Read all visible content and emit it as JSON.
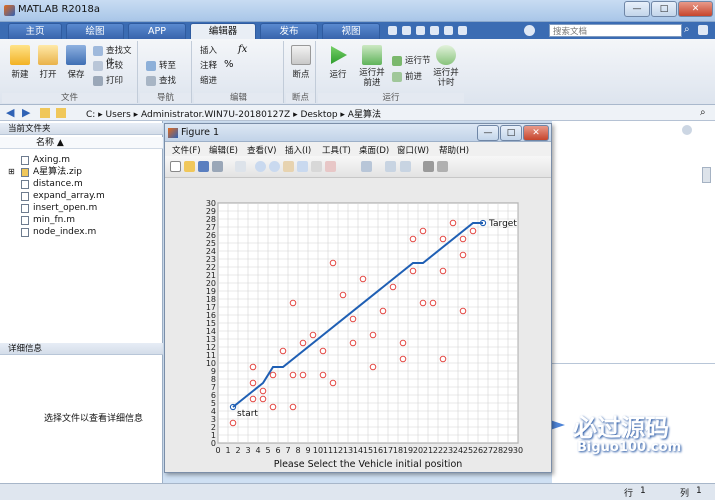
{
  "window": {
    "title": "MATLAB R2018a",
    "min": "—",
    "max": "□",
    "close": "✕"
  },
  "tabs": [
    {
      "label": "主页",
      "active": false
    },
    {
      "label": "绘图",
      "active": false
    },
    {
      "label": "APP",
      "active": false
    },
    {
      "label": "编辑器",
      "active": true
    },
    {
      "label": "发布",
      "active": false
    },
    {
      "label": "视图",
      "active": false
    }
  ],
  "search": {
    "placeholder": "搜索文档"
  },
  "toolstrip": {
    "file_group": "文件",
    "nav_group": "导航",
    "edit_group": "编辑",
    "bp_group": "断点",
    "run_group": "运行",
    "new": "新建",
    "open": "打开",
    "save": "保存",
    "find_files": "查找文件",
    "compare": "比较",
    "print": "打印",
    "goto": "转至",
    "find": "查找",
    "insert": "插入",
    "comment": "注释",
    "indent": "缩进",
    "fx": "fx",
    "percent": "%",
    "breakpoints": "断点",
    "run": "运行",
    "run_advance": "运行并\n前进",
    "run_section": "运行节",
    "advance": "前进",
    "run_time": "运行并\n计时"
  },
  "address": {
    "path": "C: ▸ Users ▸ Administrator.WIN7U-20180127Z ▸ Desktop ▸ A星算法"
  },
  "left_panel": {
    "title": "当前文件夹",
    "col_name": "名称 ▲",
    "files": [
      "Axing.m",
      "A星算法.zip",
      "distance.m",
      "expand_array.m",
      "insert_open.m",
      "min_fn.m",
      "node_index.m"
    ],
    "details_title": "详细信息",
    "details_hint": "选择文件以查看详细信息"
  },
  "status": {
    "row_label": "行",
    "row_value": "1",
    "col_label": "列",
    "col_value": "1"
  },
  "figure": {
    "title": "Figure 1",
    "menu": [
      "文件(F)",
      "编辑(E)",
      "查看(V)",
      "插入(I)",
      "工具(T)",
      "桌面(D)",
      "窗口(W)",
      "帮助(H)"
    ]
  },
  "chart_data": {
    "type": "scatter",
    "xlim": [
      0,
      30
    ],
    "ylim": [
      0,
      30
    ],
    "grid": true,
    "xlabel": "Please Select the Vehicle initial position",
    "ticks": [
      0,
      1,
      2,
      3,
      4,
      5,
      6,
      7,
      8,
      9,
      10,
      11,
      12,
      13,
      14,
      15,
      16,
      17,
      18,
      19,
      20,
      21,
      22,
      23,
      24,
      25,
      26,
      27,
      28,
      29,
      30
    ],
    "obstacles": [
      [
        1.5,
        2.5
      ],
      [
        3.5,
        9.5
      ],
      [
        3.5,
        7.5
      ],
      [
        3.5,
        5.5
      ],
      [
        4.5,
        6.5
      ],
      [
        4.5,
        5.5
      ],
      [
        5.5,
        8.5
      ],
      [
        5.5,
        4.5
      ],
      [
        6.5,
        11.5
      ],
      [
        7.5,
        17.5
      ],
      [
        7.5,
        8.5
      ],
      [
        7.5,
        4.5
      ],
      [
        8.5,
        12.5
      ],
      [
        8.5,
        8.5
      ],
      [
        9.5,
        13.5
      ],
      [
        10.5,
        11.5
      ],
      [
        10.5,
        8.5
      ],
      [
        11.5,
        22.5
      ],
      [
        11.5,
        7.5
      ],
      [
        12.5,
        18.5
      ],
      [
        13.5,
        15.5
      ],
      [
        13.5,
        12.5
      ],
      [
        14.5,
        20.5
      ],
      [
        15.5,
        13.5
      ],
      [
        15.5,
        9.5
      ],
      [
        16.5,
        16.5
      ],
      [
        17.5,
        19.5
      ],
      [
        18.5,
        12.5
      ],
      [
        18.5,
        10.5
      ],
      [
        19.5,
        25.5
      ],
      [
        19.5,
        21.5
      ],
      [
        20.5,
        26.5
      ],
      [
        20.5,
        17.5
      ],
      [
        21.5,
        17.5
      ],
      [
        22.5,
        25.5
      ],
      [
        22.5,
        21.5
      ],
      [
        22.5,
        10.5
      ],
      [
        23.5,
        27.5
      ],
      [
        24.5,
        25.5
      ],
      [
        24.5,
        23.5
      ],
      [
        24.5,
        16.5
      ],
      [
        25.5,
        26.5
      ]
    ],
    "path": [
      [
        1.5,
        4.5
      ],
      [
        4.5,
        7.5
      ],
      [
        5.5,
        9.5
      ],
      [
        6.5,
        9.5
      ],
      [
        19.5,
        22.5
      ],
      [
        20.5,
        22.5
      ],
      [
        25.5,
        27.5
      ],
      [
        26.5,
        27.5
      ]
    ],
    "start": {
      "point": [
        1.5,
        4.5
      ],
      "label": "start"
    },
    "target": {
      "point": [
        26.5,
        27.5
      ],
      "label": "Target"
    }
  },
  "watermark": {
    "text": "必过源码",
    "url": "Biguo100.com"
  },
  "colors": {
    "path": "#1f5fb4",
    "obstacle": "#e0342f",
    "grid": "#d2d2d2"
  }
}
